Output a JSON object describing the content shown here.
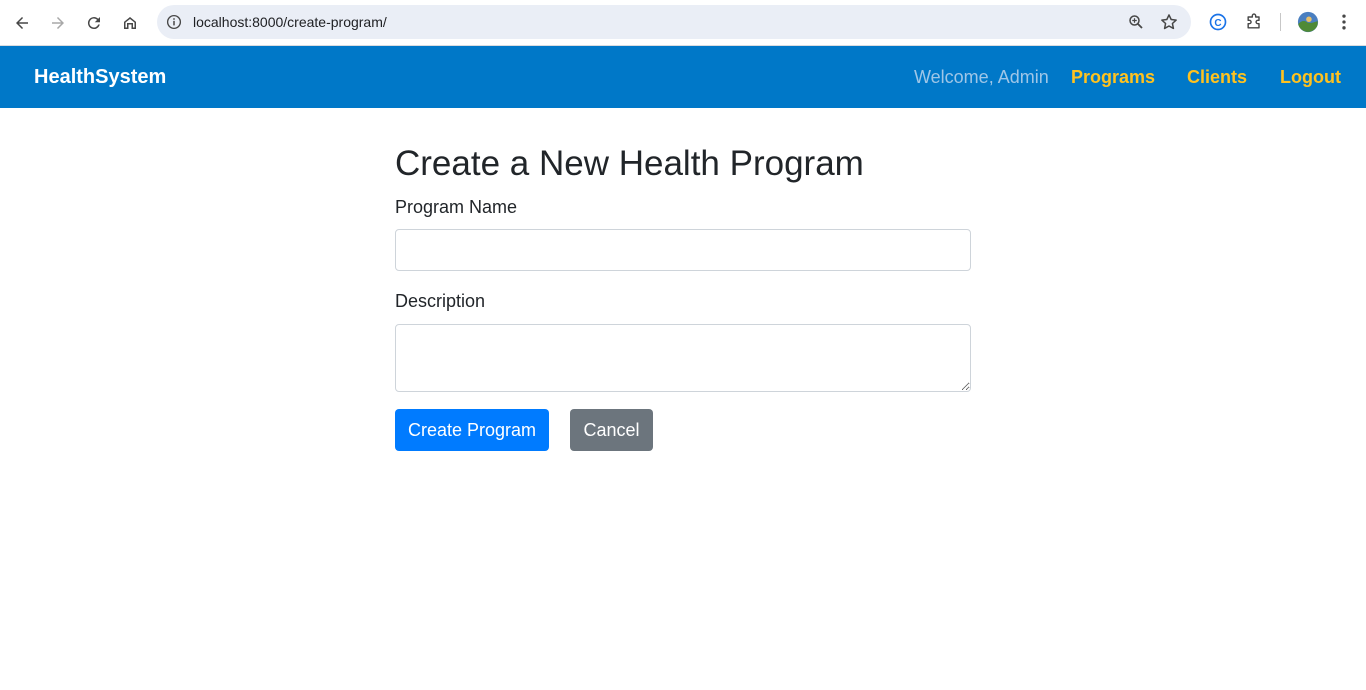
{
  "browser": {
    "url": "localhost:8000/create-program/",
    "icons": [
      "back-arrow-icon",
      "forward-arrow-icon",
      "reload-icon",
      "home-icon",
      "site-info-icon",
      "zoom-icon",
      "bookmark-star-icon",
      "extension-c-icon",
      "extensions-puzzle-icon",
      "profile-avatar",
      "more-menu-icon"
    ]
  },
  "navbar": {
    "brand": "HealthSystem",
    "welcome": "Welcome, Admin",
    "links": [
      "Programs",
      "Clients",
      "Logout"
    ],
    "colors": {
      "background": "#0078c8",
      "link": "#ffc21f",
      "welcome": "#9fc6e7"
    }
  },
  "form": {
    "title": "Create a New Health Program",
    "program_name_label": "Program Name",
    "program_name_value": "",
    "description_label": "Description",
    "description_value": "",
    "submit_label": "Create Program",
    "cancel_label": "Cancel",
    "colors": {
      "submit": "#007bff",
      "cancel": "#6c757d"
    }
  }
}
